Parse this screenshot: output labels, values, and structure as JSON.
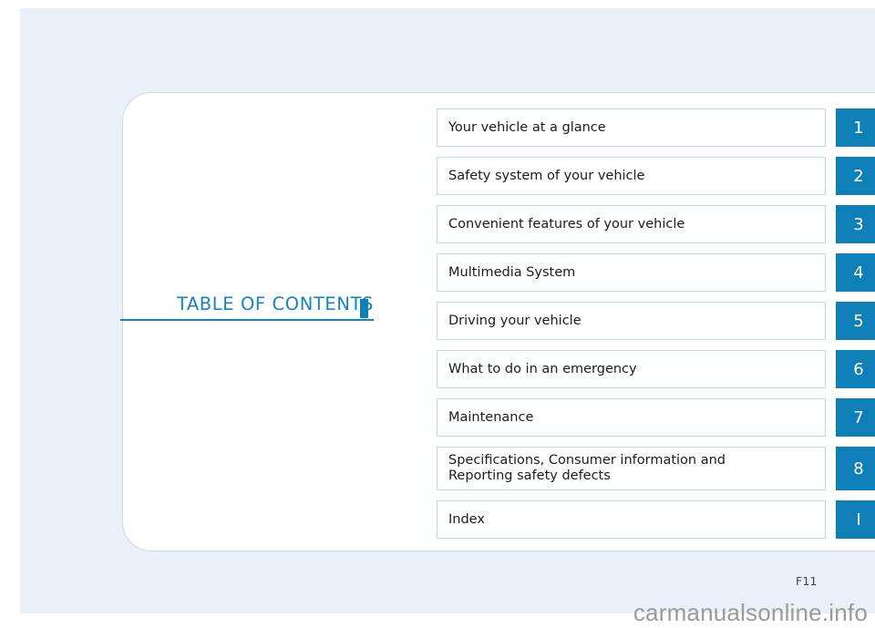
{
  "document": {
    "section_label": "TABLE OF CONTENTS",
    "page_number": "F11",
    "watermark": "carmanualsonline.info"
  },
  "theme": {
    "accent_blue": "#0f7fb8",
    "label_blue": "#1682be",
    "row_border": "#bcd8ec",
    "page_background": "#e9f0f8",
    "panel_background": "#ffffff"
  },
  "contents": {
    "rows": [
      {
        "title": "Your vehicle at a glance",
        "number": "1",
        "tall": false
      },
      {
        "title": "Safety system of your vehicle",
        "number": "2",
        "tall": false
      },
      {
        "title": "Convenient features of your vehicle",
        "number": "3",
        "tall": false
      },
      {
        "title": "Multimedia System",
        "number": "4",
        "tall": false
      },
      {
        "title": "Driving your vehicle",
        "number": "5",
        "tall": false
      },
      {
        "title": "What to do in an emergency",
        "number": "6",
        "tall": false
      },
      {
        "title": "Maintenance",
        "number": "7",
        "tall": false
      },
      {
        "title": "Specifications, Consumer information and\nReporting safety defects",
        "number": "8",
        "tall": true
      },
      {
        "title": "Index",
        "number": "I",
        "tall": false
      }
    ]
  }
}
